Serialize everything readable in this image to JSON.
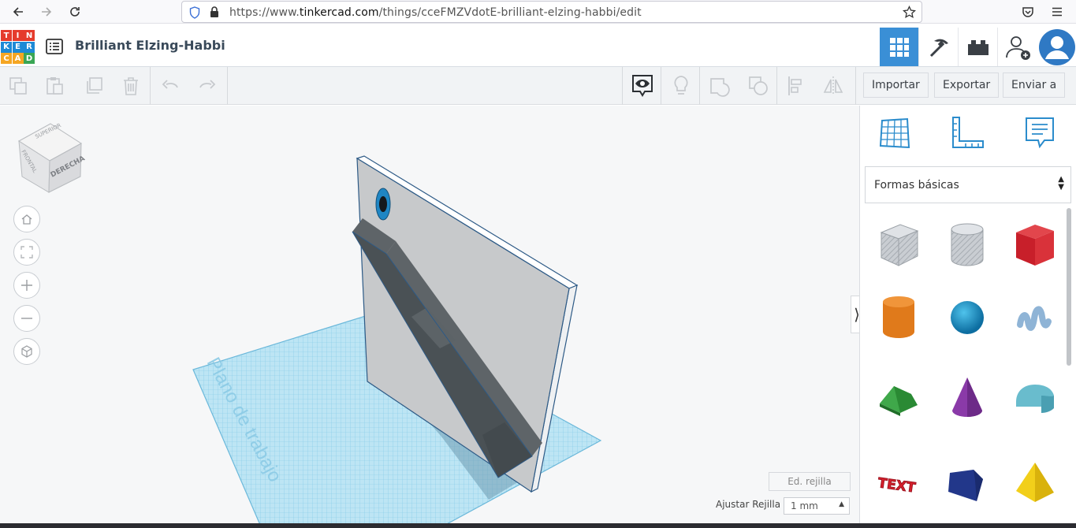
{
  "browser": {
    "url_prefix": "https://www.",
    "url_host": "tinkercad.com",
    "url_path": "/things/cceFMZVdotE-brilliant-elzing-habbi/edit"
  },
  "app": {
    "logo_letters": [
      "T",
      "I",
      "N",
      "K",
      "E",
      "R",
      "C",
      "A",
      "D"
    ],
    "logo_colors": [
      "#e53b2c",
      "#e53b2c",
      "#e53b2c",
      "#1e8ad6",
      "#1e8ad6",
      "#1e8ad6",
      "#f5a623",
      "#f5a623",
      "#3aa655"
    ],
    "design_title": "Brilliant Elzing-Habbi",
    "accent": "#3a8fd6"
  },
  "toolbar": {
    "import_label": "Importar",
    "export_label": "Exportar",
    "send_label": "Enviar a"
  },
  "view_cube": {
    "top_label": "SUPERIOR",
    "front_label": "FRONTAL",
    "right_label": "DERECHA"
  },
  "workplane": {
    "label": "Plano de trabajo",
    "edit_grid_label": "Ed. rejilla",
    "snap_label": "Ajustar Rejilla",
    "snap_value": "1 mm"
  },
  "panel": {
    "category": "Formas básicas",
    "shapes": [
      "box-hole",
      "cylinder-hole",
      "box",
      "cylinder",
      "sphere",
      "scribble",
      "roof",
      "cone",
      "round-roof",
      "text",
      "polygon",
      "pyramid"
    ],
    "text_shape_label": "TEXT"
  }
}
